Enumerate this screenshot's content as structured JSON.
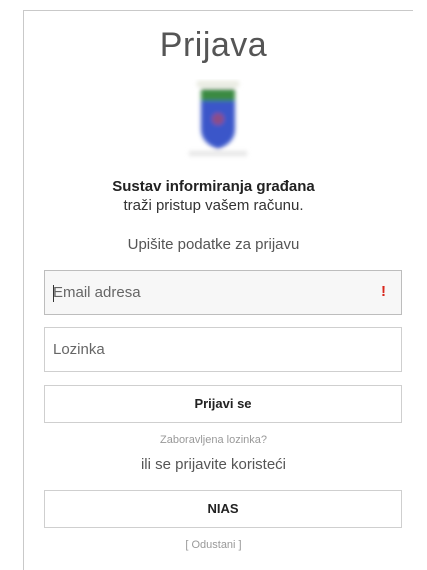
{
  "header": {
    "title": "Prijava"
  },
  "client": {
    "logo_icon": "coat-of-arms-icon",
    "name": "Sustav informiranja građana",
    "subtitle": "traži pristup vašem računu."
  },
  "form": {
    "instruction": "Upišite podatke za prijavu",
    "email": {
      "placeholder": "Email adresa",
      "value": "",
      "required_marker": "!"
    },
    "password": {
      "placeholder": "Lozinka",
      "value": ""
    },
    "submit_label": "Prijavi se",
    "forgot_password": "Zaboravljena lozinka?",
    "alternative_text": "ili se prijavite koristeći",
    "nias_label": "NIAS",
    "cancel_label": "[ Odustani ]"
  },
  "colors": {
    "required_marker": "#d9261c",
    "crest_blue": "#3b56c9",
    "crest_green": "#2f7d3b"
  }
}
